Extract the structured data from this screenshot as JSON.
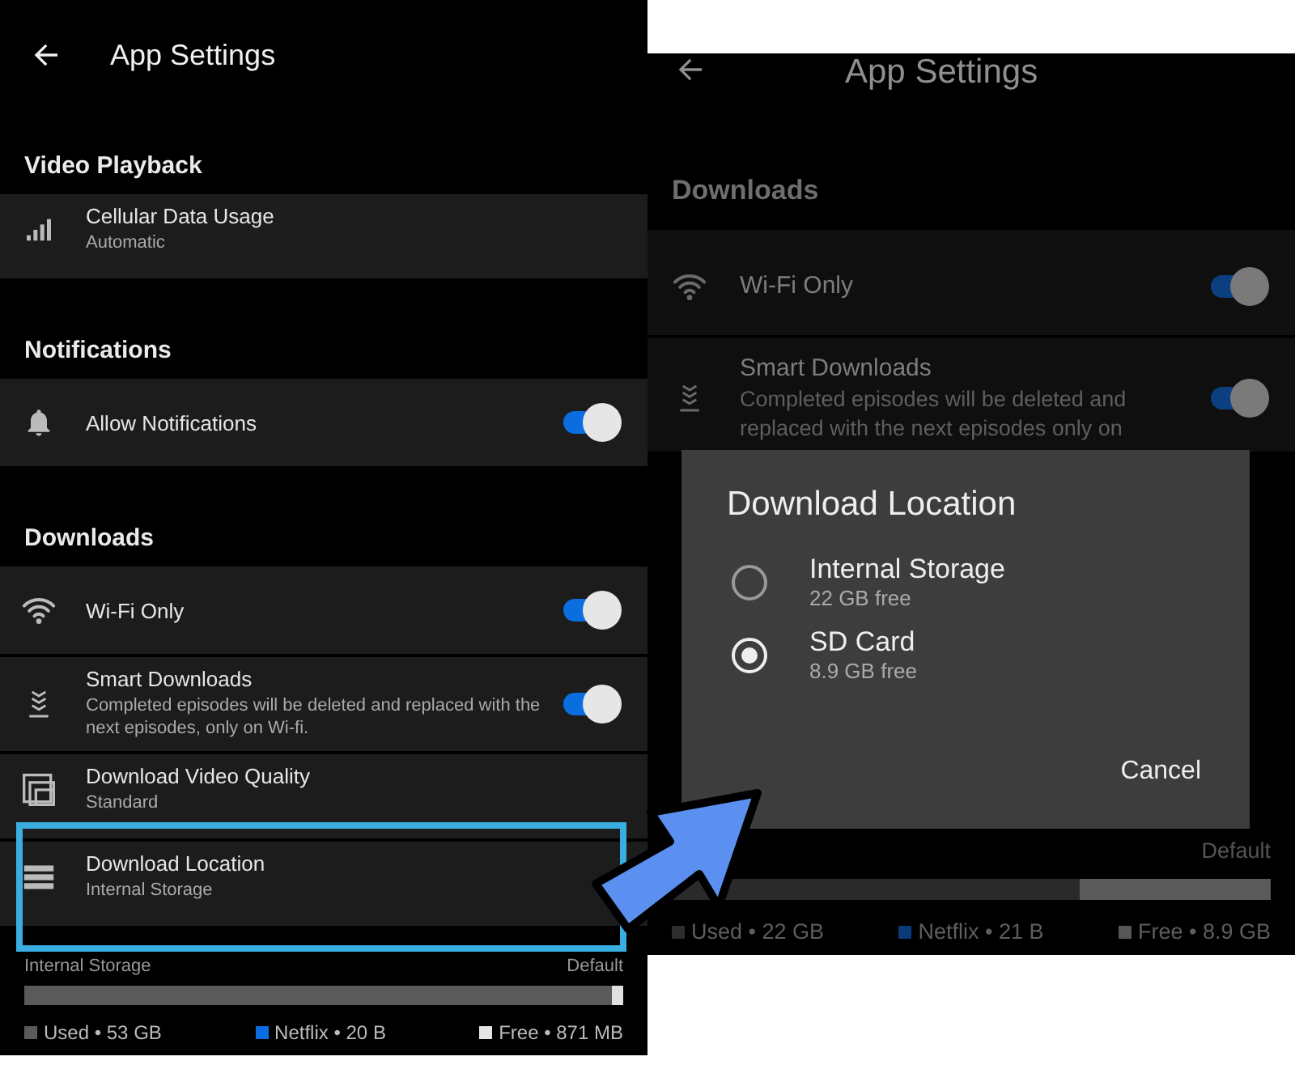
{
  "left_screen": {
    "title": "App Settings",
    "sections": [
      {
        "heading": "Video Playback",
        "rows": [
          {
            "kind": "info",
            "title": "Cellular Data Usage",
            "subtitle": "Automatic"
          }
        ]
      },
      {
        "heading": "Notifications",
        "rows": [
          {
            "kind": "toggle",
            "title": "Allow Notifications",
            "on": true
          }
        ]
      },
      {
        "heading": "Downloads",
        "rows": [
          {
            "kind": "toggle",
            "title": "Wi-Fi Only",
            "on": true
          },
          {
            "kind": "toggle",
            "title": "Smart Downloads",
            "subtitle": "Completed episodes will be deleted and replaced with the next episodes, only on Wi-fi.",
            "on": true
          },
          {
            "kind": "info",
            "title": "Download Video Quality",
            "subtitle": "Standard"
          },
          {
            "kind": "info",
            "title": "Download Location",
            "subtitle": "Internal Storage"
          }
        ]
      }
    ],
    "storage": {
      "label": "Internal Storage",
      "default_label": "Default",
      "level": 0.98,
      "legend": [
        {
          "label": "Used • 53 GB",
          "color": "#5a5a5a"
        },
        {
          "label": "Netflix • 20 B",
          "color": "#0a6ee0"
        },
        {
          "label": "Free • 871 MB",
          "color": "#e5e5e5"
        }
      ]
    }
  },
  "right_screen": {
    "title": "App Settings",
    "sections": [
      {
        "heading": "Downloads",
        "rows": [
          {
            "kind": "toggle",
            "title": "Wi-Fi Only",
            "on": true
          },
          {
            "kind": "toggle",
            "title": "Smart Downloads",
            "subtitle": "Completed episodes will be deleted and replaced with the next episodes only on",
            "on": true
          }
        ]
      }
    ],
    "dialog": {
      "title": "Download Location",
      "options": [
        {
          "label": "Internal Storage",
          "detail": "22 GB free",
          "selected": false
        },
        {
          "label": "SD Card",
          "detail": "8.9 GB free",
          "selected": true
        }
      ],
      "button": "Cancel"
    },
    "storage": {
      "default_label": "Default",
      "level": 0.68,
      "legend": [
        {
          "label": "Used • 22 GB",
          "color": "#2e2e2e"
        },
        {
          "label": "Netflix • 21 B",
          "color": "#0b3a78"
        },
        {
          "label": "Free • 8.9 GB",
          "color": "#575757"
        }
      ]
    }
  }
}
